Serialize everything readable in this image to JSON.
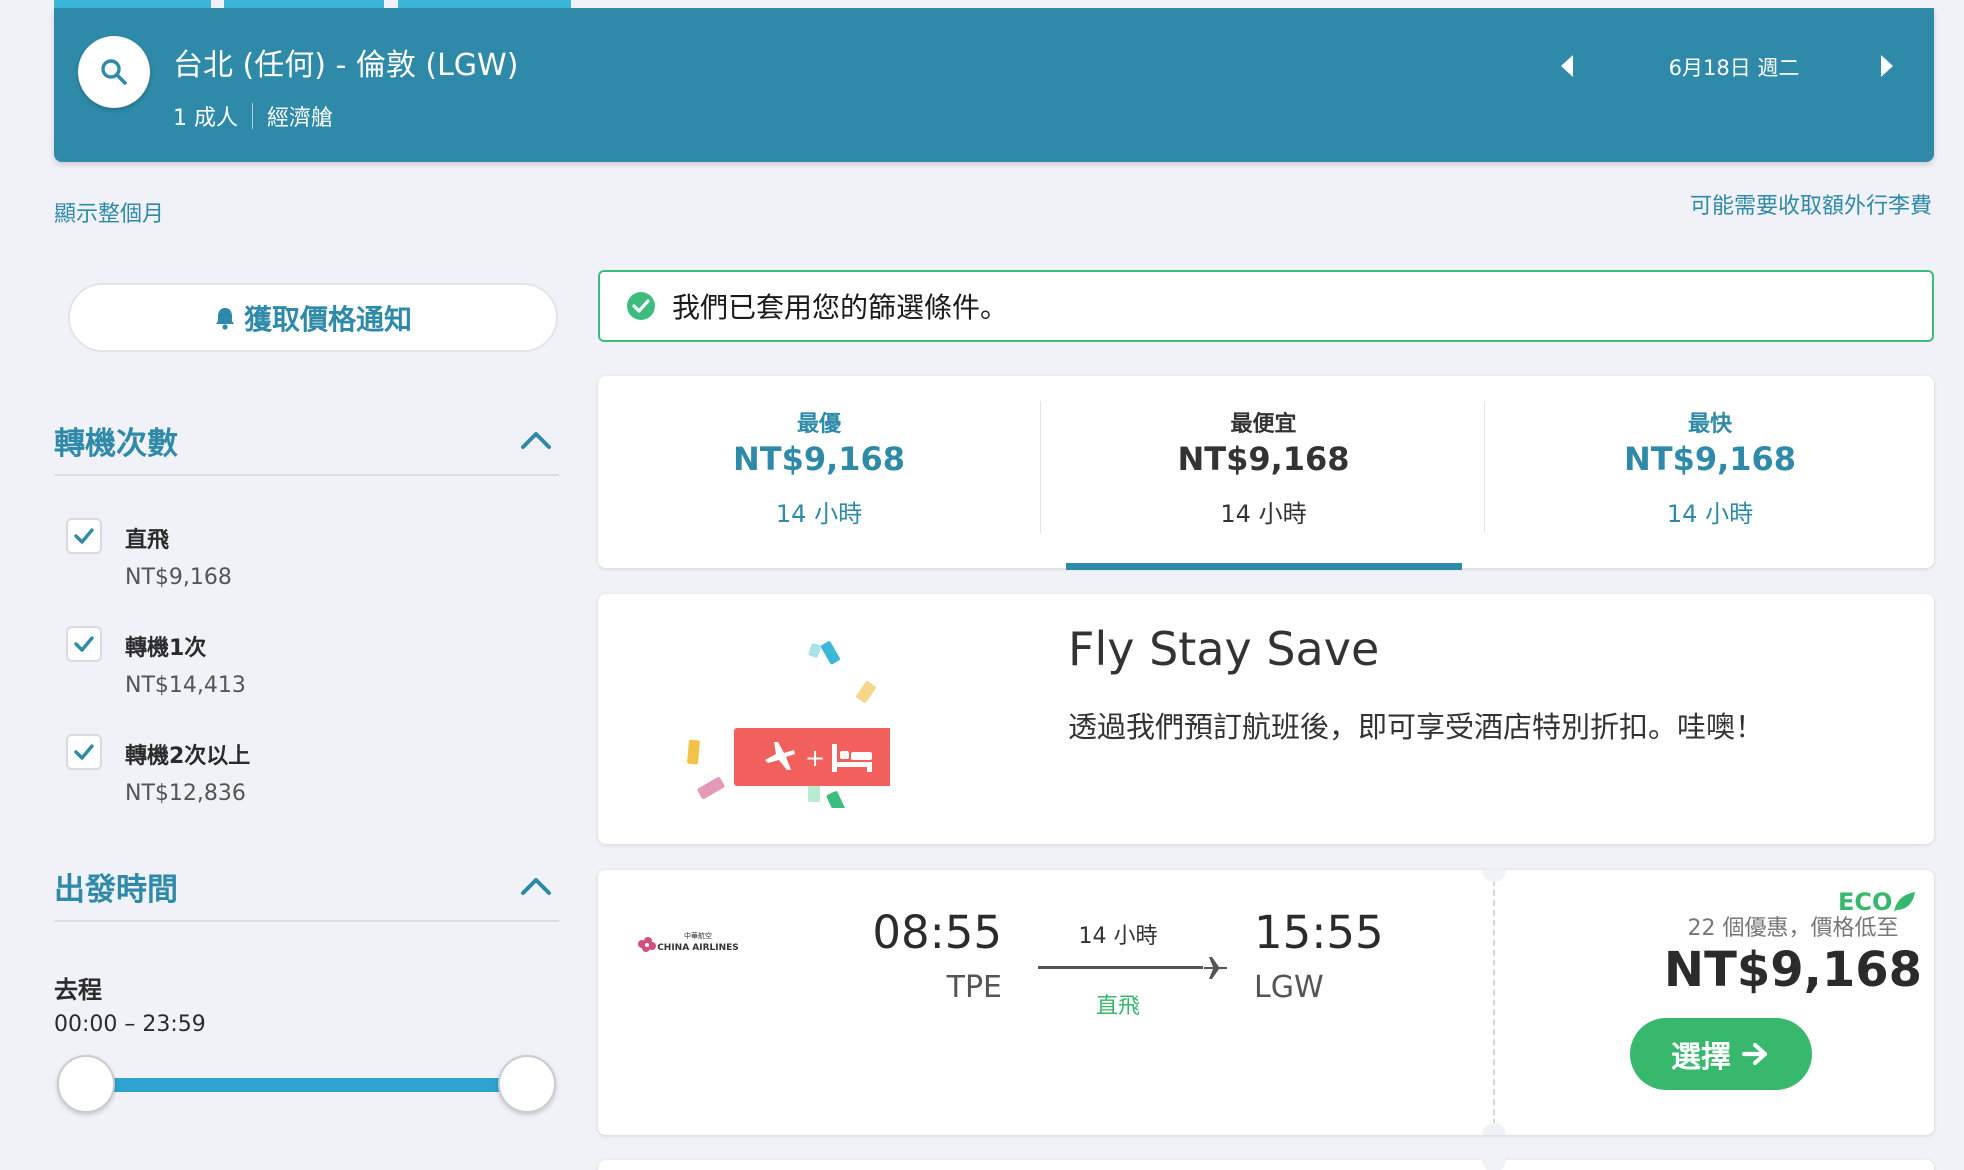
{
  "header": {
    "route": "台北 (任何) - 倫敦 (LGW)",
    "passengers": "1 成人",
    "cabin": "經濟艙",
    "date": "6月18日 週二"
  },
  "links": {
    "show_month": "顯示整個月",
    "baggage_fee": "可能需要收取額外行李費"
  },
  "sidebar": {
    "price_alert": "獲取價格通知",
    "stops": {
      "title": "轉機次數",
      "options": [
        {
          "label": "直飛",
          "price": "NT$9,168",
          "checked": true
        },
        {
          "label": "轉機1次",
          "price": "NT$14,413",
          "checked": true
        },
        {
          "label": "轉機2次以上",
          "price": "NT$12,836",
          "checked": true
        }
      ]
    },
    "departure": {
      "title": "出發時間",
      "leg": "去程",
      "range": "00:00 – 23:59",
      "slider_min_fraction": 0,
      "slider_max_fraction": 1
    }
  },
  "notice": "我們已套用您的篩選條件。",
  "sort": [
    {
      "label": "最優",
      "price": "NT$9,168",
      "duration": "14 小時"
    },
    {
      "label": "最便宜",
      "price": "NT$9,168",
      "duration": "14 小時"
    },
    {
      "label": "最快",
      "price": "NT$9,168",
      "duration": "14 小時"
    }
  ],
  "promo": {
    "title": "Fly Stay Save",
    "text": "透過我們預訂航班後，即可享受酒店特別折扣。哇噢！",
    "badge": "+"
  },
  "flight": {
    "airline_cn": "中華航空",
    "airline_en": "CHINA AIRLINES",
    "depart_time": "08:55",
    "depart_code": "TPE",
    "duration": "14 小時",
    "stops": "直飛",
    "arrive_time": "15:55",
    "arrive_code": "LGW",
    "eco": "ECO",
    "deals": "22 個優惠，價格低至",
    "price": "NT$9,168",
    "select": "選擇"
  },
  "colors": {
    "primary": "#2e8aa8",
    "accent": "#3cb7d8",
    "green": "#38b86d",
    "promo_red": "#f2605e"
  }
}
